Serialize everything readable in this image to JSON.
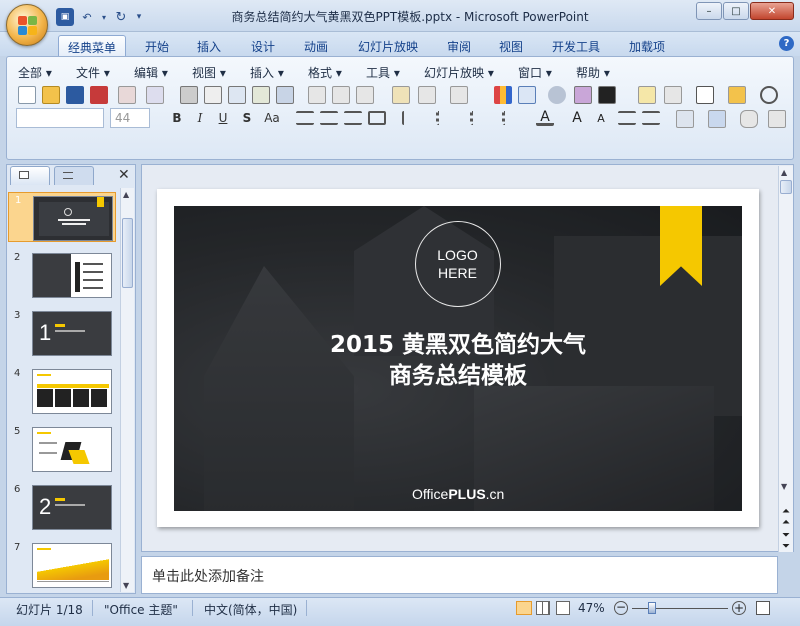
{
  "window": {
    "title": "商务总结简约大气黄黑双色PPT模板.pptx - Microsoft PowerPoint",
    "min_label": "–",
    "max_label": "□",
    "close_label": "✕"
  },
  "ribbon_tabs": [
    "经典菜单",
    "开始",
    "插入",
    "设计",
    "动画",
    "幻灯片放映",
    "审阅",
    "视图",
    "开发工具",
    "加载项"
  ],
  "help_label": "?",
  "classic_menu": [
    "全部 ▾",
    "文件 ▾",
    "编辑 ▾",
    "视图 ▾",
    "插入 ▾",
    "格式 ▾",
    "工具 ▾",
    "幻灯片放映 ▾",
    "窗口 ▾",
    "帮助 ▾"
  ],
  "font_box": {
    "name": "",
    "size": "44"
  },
  "format_buttons": [
    "B",
    "I",
    "U",
    "S",
    "Aa"
  ],
  "panel": {
    "close_label": "✕"
  },
  "thumbnails": [
    {
      "num": "1",
      "label": ""
    },
    {
      "num": "2",
      "label": ""
    },
    {
      "num": "3",
      "label": "1"
    },
    {
      "num": "4",
      "label": ""
    },
    {
      "num": "5",
      "label": ""
    },
    {
      "num": "6",
      "label": "2"
    },
    {
      "num": "7",
      "label": ""
    }
  ],
  "slide": {
    "logo_line1": "LOGO",
    "logo_line2": "HERE",
    "title_line1": "2015 黄黑双色简约大气",
    "title_line2": "商务总结模板",
    "brand_a": "Office",
    "brand_b": "PLUS",
    "brand_c": ".cn",
    "accent_color": "#f5c800"
  },
  "notes_placeholder": "单击此处添加备注",
  "status": {
    "slide_info": "幻灯片 1/18",
    "theme": "\"Office 主题\"",
    "language": "中文(简体，中国)",
    "zoom": "47%"
  }
}
